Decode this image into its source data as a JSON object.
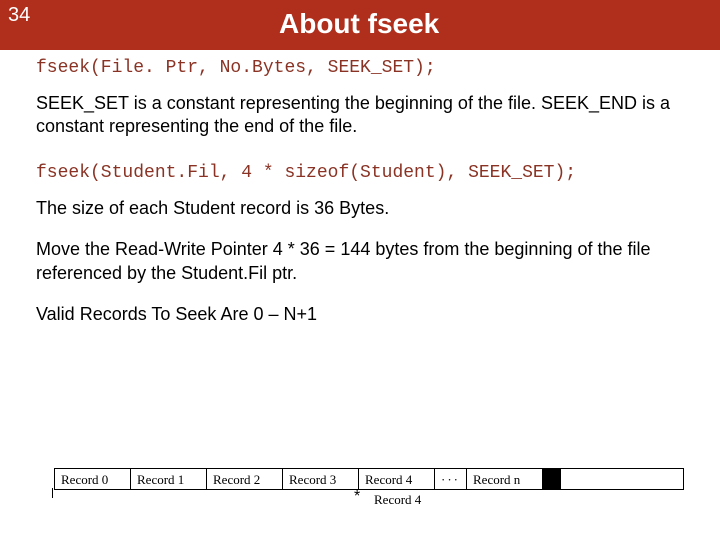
{
  "header": {
    "page_number": "34",
    "title": "About fseek"
  },
  "code": {
    "line1": "fseek(File. Ptr, No.Bytes, SEEK_SET);",
    "line2": "fseek(Student.Fil, 4 * sizeof(Student), SEEK_SET);"
  },
  "text": {
    "para1": "SEEK_SET is a constant representing the beginning of the file.  SEEK_END is a constant representing the end of the file.",
    "para2": "The size of each Student record is 36 Bytes.",
    "para3": "Move the Read-Write Pointer 4 * 36 = 144 bytes from the beginning of the file referenced by the Student.Fil ptr.",
    "para4": "Valid Records To Seek Are 0 – N+1"
  },
  "records": {
    "cells": [
      "Record 0",
      "Record 1",
      "Record 2",
      "Record 3",
      "Record 4",
      "Record n"
    ],
    "dots": "···",
    "pointer_marker": "*",
    "pointer_label": "Record 4"
  }
}
